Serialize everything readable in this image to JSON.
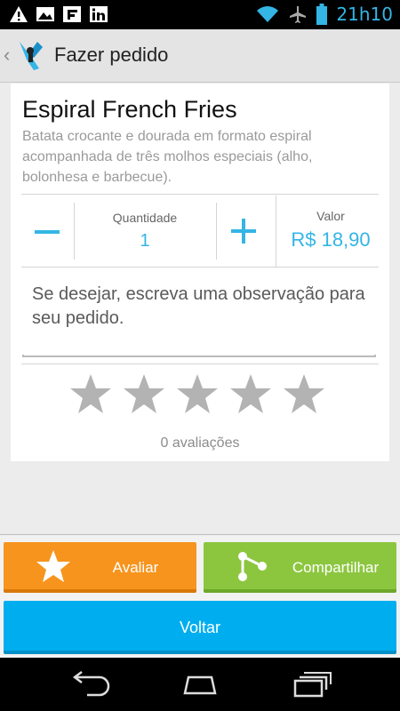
{
  "status_bar": {
    "time": "21h10",
    "notification_icons": [
      "warning-icon",
      "gallery-icon",
      "flipboard-icon",
      "linkedin-icon"
    ],
    "system_icons": [
      "wifi-icon",
      "airplane-icon",
      "battery-icon"
    ]
  },
  "action_bar": {
    "title": "Fazer pedido",
    "back_icon": "chevron-left-icon",
    "app_icon": "app-logo-icon"
  },
  "product": {
    "name": "Espiral French Fries",
    "description": "Batata crocante e dourada em formato espiral acompanhada de três molhos especiais (alho, bolonhesa e barbecue)."
  },
  "order": {
    "quantity_label": "Quantidade",
    "quantity": "1",
    "price_label": "Valor",
    "price": "R$ 18,90"
  },
  "observation": {
    "placeholder": "Se desejar, escreva uma observação para seu pedido."
  },
  "rating": {
    "stars_total": 5,
    "stars_filled": 0,
    "count_text": "0 avaliações"
  },
  "actions": {
    "rate_label": "Avaliar",
    "share_label": "Compartilhar",
    "back_label": "Voltar"
  },
  "colors": {
    "accent": "#33b5e5",
    "rate_button": "#f7941d",
    "share_button": "#8cc63f",
    "back_button": "#00aeef"
  },
  "nav_bar": {
    "icons": [
      "back-nav-icon",
      "home-nav-icon",
      "recents-nav-icon"
    ]
  }
}
